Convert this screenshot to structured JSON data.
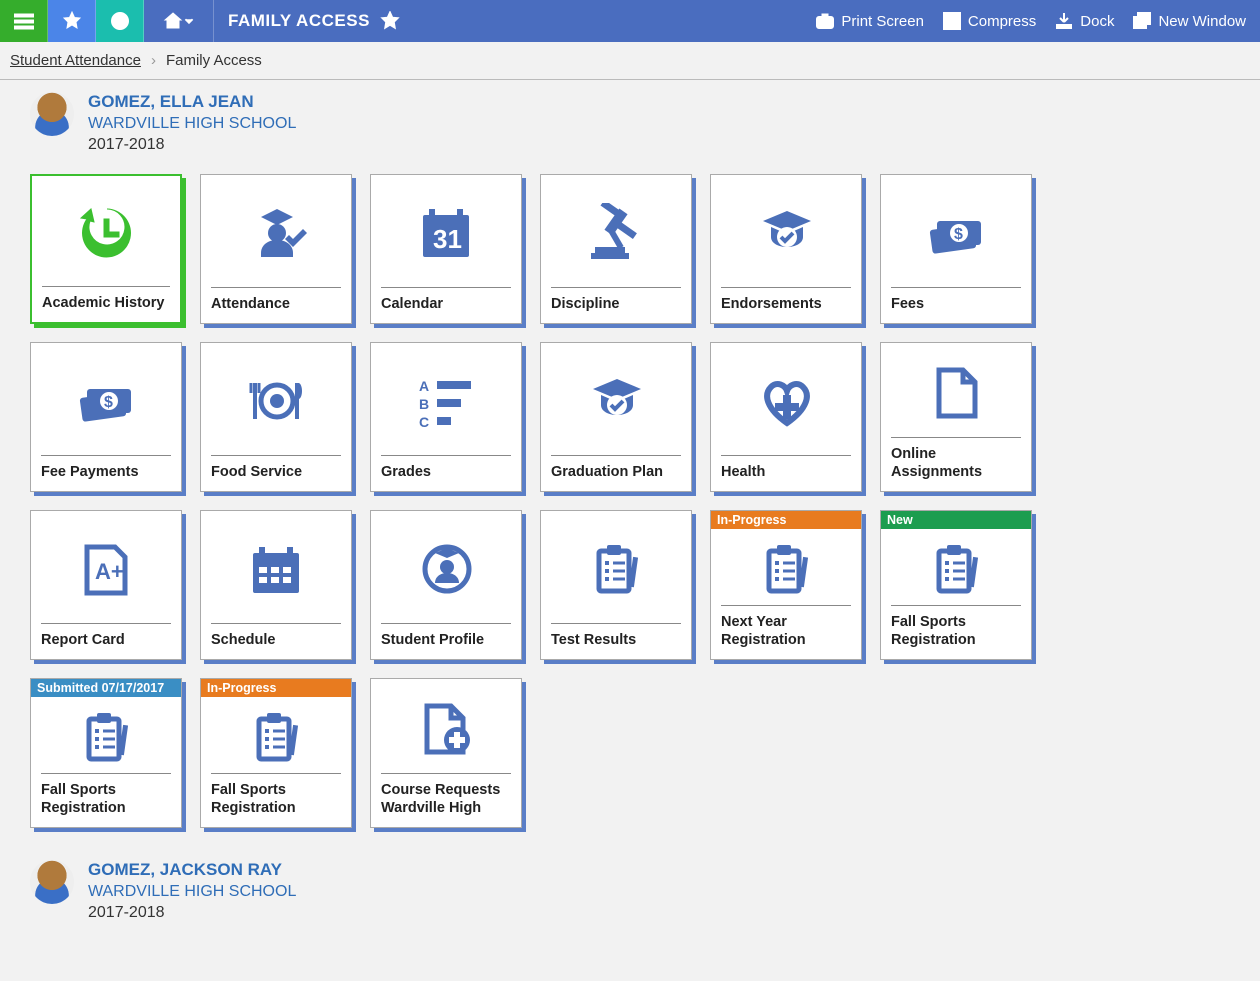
{
  "topbar": {
    "title": "FAMILY ACCESS",
    "actions": {
      "print": "Print Screen",
      "compress": "Compress",
      "dock": "Dock",
      "newwin": "New Window"
    }
  },
  "breadcrumb": {
    "parent": "Student Attendance",
    "current": "Family Access"
  },
  "students": [
    {
      "name": "GOMEZ, ELLA JEAN",
      "school": "WARDVILLE HIGH SCHOOL",
      "year": "2017-2018",
      "tiles": [
        {
          "label": "Academic History",
          "icon": "history",
          "active": true
        },
        {
          "label": "Attendance",
          "icon": "attendance"
        },
        {
          "label": "Calendar",
          "icon": "calendar"
        },
        {
          "label": "Discipline",
          "icon": "gavel"
        },
        {
          "label": "Endorsements",
          "icon": "gradcheck"
        },
        {
          "label": "Fees",
          "icon": "money"
        },
        {
          "label": "Fee Payments",
          "icon": "money"
        },
        {
          "label": "Food Service",
          "icon": "food"
        },
        {
          "label": "Grades",
          "icon": "grades"
        },
        {
          "label": "Graduation Plan",
          "icon": "gradcheck"
        },
        {
          "label": "Health",
          "icon": "health"
        },
        {
          "label": "Online Assignments",
          "icon": "doc"
        },
        {
          "label": "Report Card",
          "icon": "reportcard"
        },
        {
          "label": "Schedule",
          "icon": "schedule"
        },
        {
          "label": "Student Profile",
          "icon": "profile"
        },
        {
          "label": "Test Results",
          "icon": "clipboard"
        },
        {
          "label": "Next Year Registration",
          "icon": "clipboard",
          "badge": {
            "text": "In-Progress",
            "color": "orange"
          }
        },
        {
          "label": "Fall Sports Registration",
          "icon": "clipboard",
          "badge": {
            "text": "New",
            "color": "green"
          }
        },
        {
          "label": "Fall Sports Registration",
          "icon": "clipboard",
          "badge": {
            "text": "Submitted 07/17/2017",
            "color": "steelblue"
          }
        },
        {
          "label": "Fall Sports Registration",
          "icon": "clipboard",
          "badge": {
            "text": "In-Progress",
            "color": "orange"
          }
        },
        {
          "label": "Course Requests Wardville High",
          "icon": "docplus"
        }
      ]
    },
    {
      "name": "GOMEZ, JACKSON RAY",
      "school": "WARDVILLE HIGH SCHOOL",
      "year": "2017-2018",
      "tiles": []
    }
  ]
}
